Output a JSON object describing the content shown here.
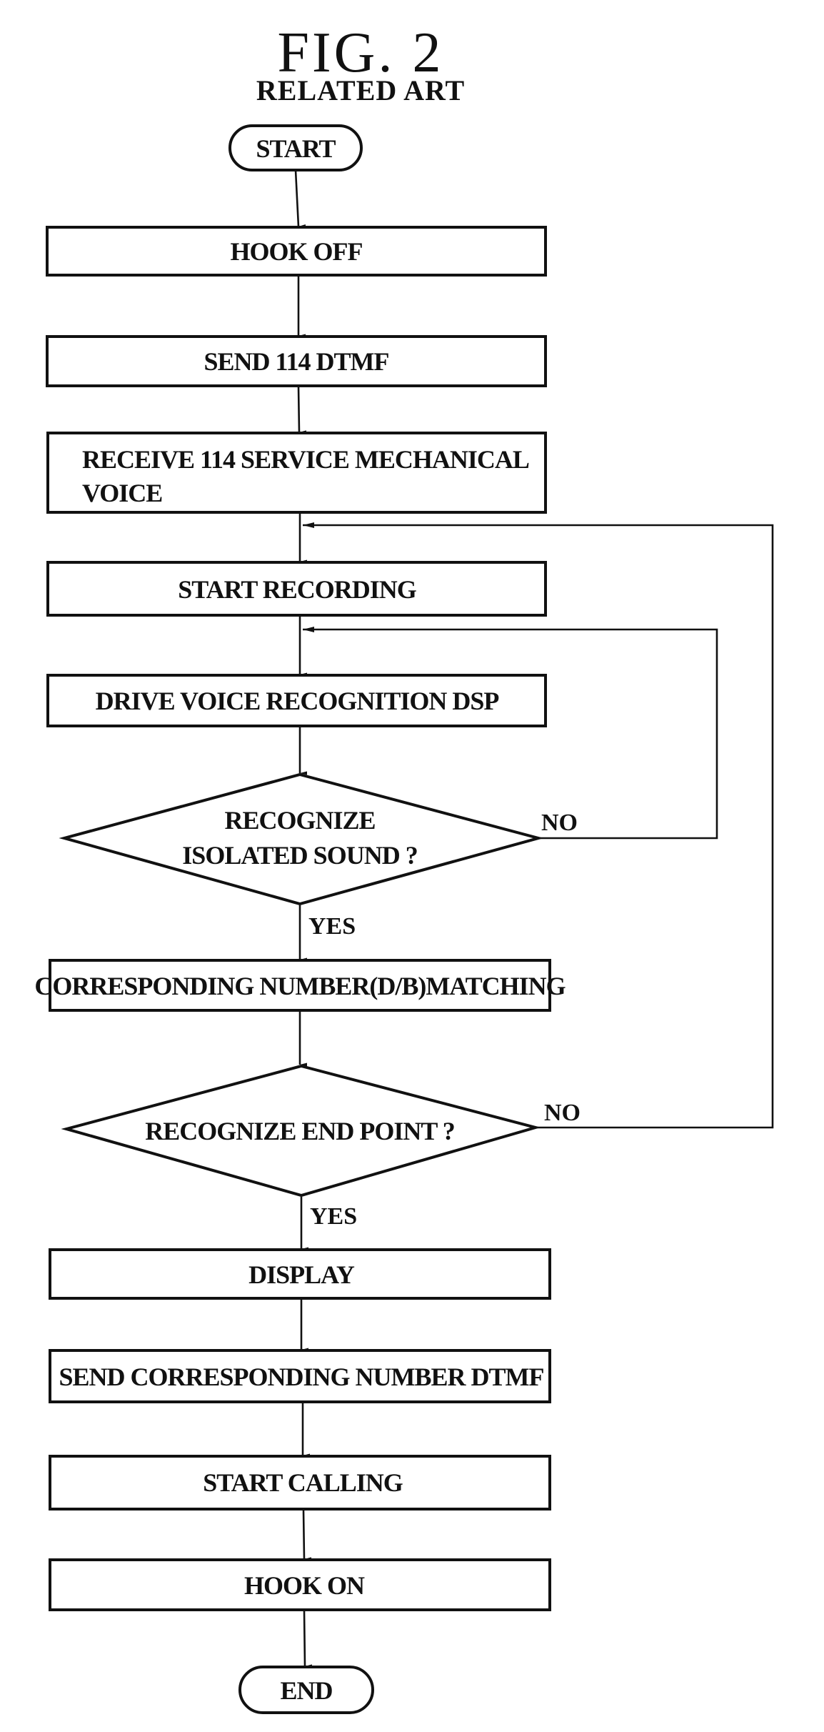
{
  "figure": {
    "title": "FIG.  2",
    "subtitle": "RELATED ART"
  },
  "colors": {
    "ink": "#111111",
    "paper": "#ffffff"
  },
  "flowchart": {
    "start": "START",
    "end": "END",
    "steps": {
      "hook_off": "HOOK OFF",
      "send_114_dtmf": "SEND 114 DTMF",
      "receive_line1": "RECEIVE 114 SERVICE MECHANICAL",
      "receive_line2": "VOICE",
      "start_recording": "START RECORDING",
      "drive_dsp": "DRIVE VOICE RECOGNITION DSP",
      "matching": "CORRESPONDING NUMBER(D/B)MATCHING",
      "display": "DISPLAY",
      "send_number_dtmf": "SEND CORRESPONDING NUMBER DTMF",
      "start_calling": "START CALLING",
      "hook_on": "HOOK ON"
    },
    "decisions": {
      "isolated_line1": "RECOGNIZE",
      "isolated_line2": "ISOLATED SOUND ?",
      "end_point": "RECOGNIZE END POINT ?"
    },
    "branches": {
      "yes": "YES",
      "no": "NO"
    }
  }
}
